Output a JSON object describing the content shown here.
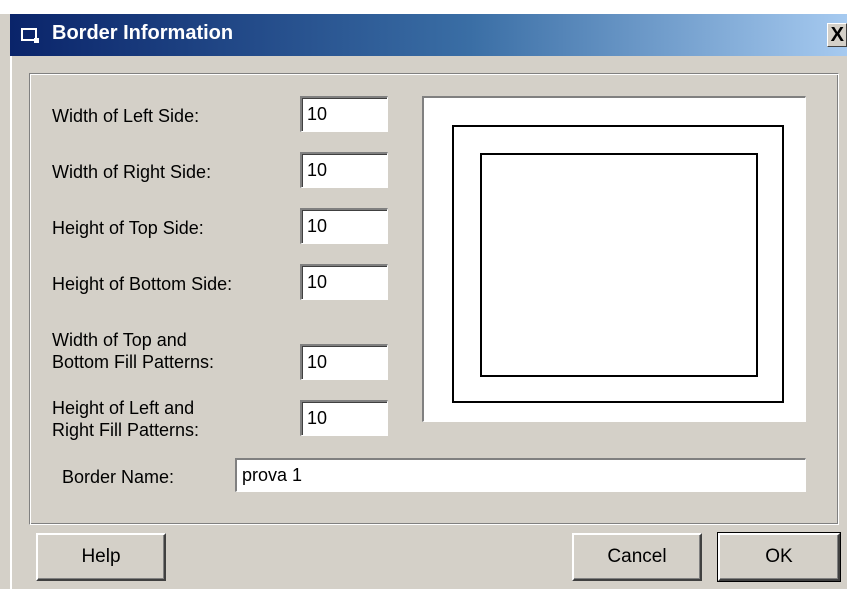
{
  "window": {
    "title": "Border Information",
    "icon": "app-icon",
    "close_label": "X"
  },
  "fields": [
    {
      "label": "Width of Left Side:",
      "value": "10"
    },
    {
      "label": "Width of Right Side:",
      "value": "10"
    },
    {
      "label": "Height of Top Side:",
      "value": "10"
    },
    {
      "label": "Height of Bottom Side:",
      "value": "10"
    },
    {
      "label_line1": "Width of Top and",
      "label_line2": "Bottom Fill Patterns:",
      "value": "10"
    },
    {
      "label_line1": "Height of Left and",
      "label_line2": "Right Fill Patterns:",
      "value": "10"
    }
  ],
  "border_name": {
    "label": "Border Name:",
    "value": "prova 1"
  },
  "buttons": {
    "help": "Help",
    "cancel": "Cancel",
    "ok": "OK"
  }
}
